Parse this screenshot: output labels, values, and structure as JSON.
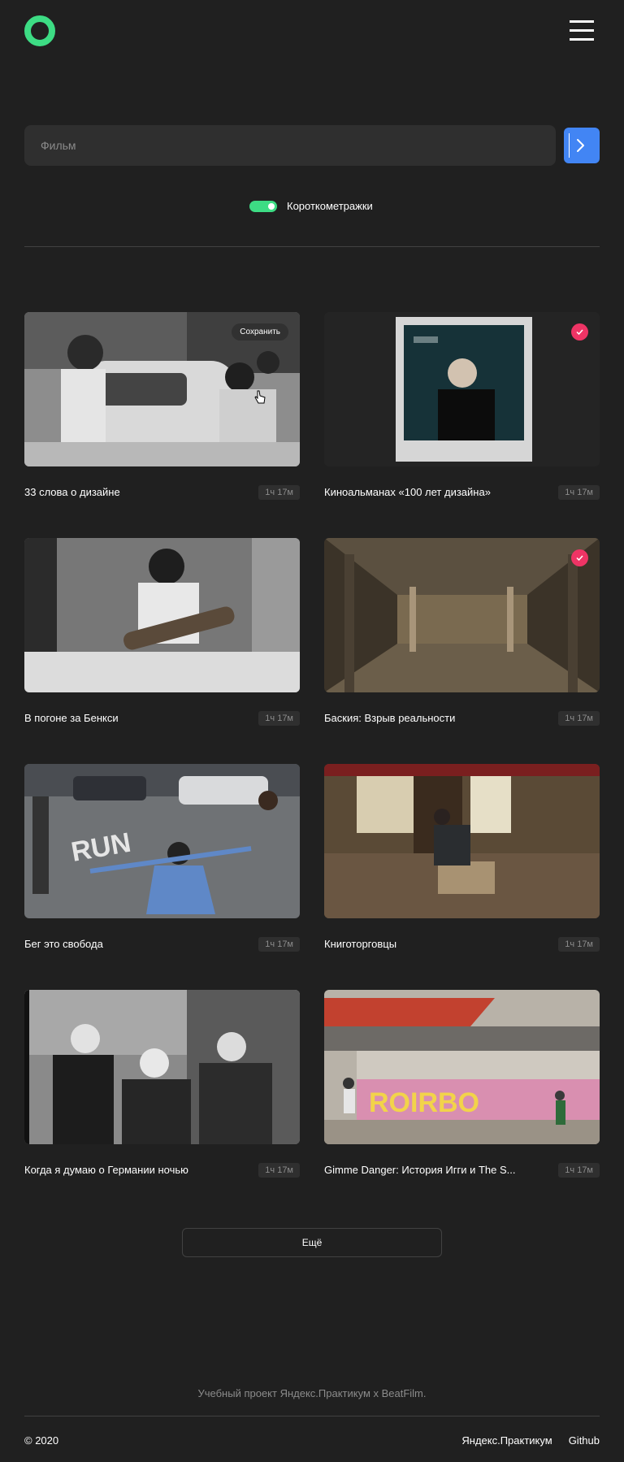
{
  "header": {
    "logo_icon": "ring-logo-icon",
    "menu_icon": "hamburger-menu-icon"
  },
  "search": {
    "placeholder": "Фильм",
    "value": "",
    "button_icon": "chevron-right-icon"
  },
  "filter": {
    "shorts_label": "Короткометражки",
    "shorts_enabled": true
  },
  "colors": {
    "accent_green": "#3ddc84",
    "accent_blue": "#4285f4",
    "saved_pink": "#ee3465",
    "background": "#202020"
  },
  "movies": [
    {
      "title": "33 слова о дизайне",
      "duration": "1ч 17м",
      "state": "hover",
      "save_label": "Сохранить"
    },
    {
      "title": "Киноальманах «100 лет дизайна»",
      "duration": "1ч 17м",
      "state": "saved"
    },
    {
      "title": "В погоне за Бенкси",
      "duration": "1ч 17м",
      "state": "default"
    },
    {
      "title": "Баския: Взрыв реальности",
      "duration": "1ч 17м",
      "state": "saved"
    },
    {
      "title": "Бег это свобода",
      "duration": "1ч 17м",
      "state": "default"
    },
    {
      "title": "Книготорговцы",
      "duration": "1ч 17м",
      "state": "default"
    },
    {
      "title": "Когда я думаю о Германии ночью",
      "duration": "1ч 17м",
      "state": "default"
    },
    {
      "title": "Gimme Danger: История Игги и The S...",
      "duration": "1ч 17м",
      "state": "default"
    }
  ],
  "more_button": "Ещё",
  "footer": {
    "note": "Учебный проект Яндекс.Практикум х BeatFilm.",
    "copyright": "© 2020",
    "links": [
      "Яндекс.Практикум",
      "Github"
    ]
  }
}
